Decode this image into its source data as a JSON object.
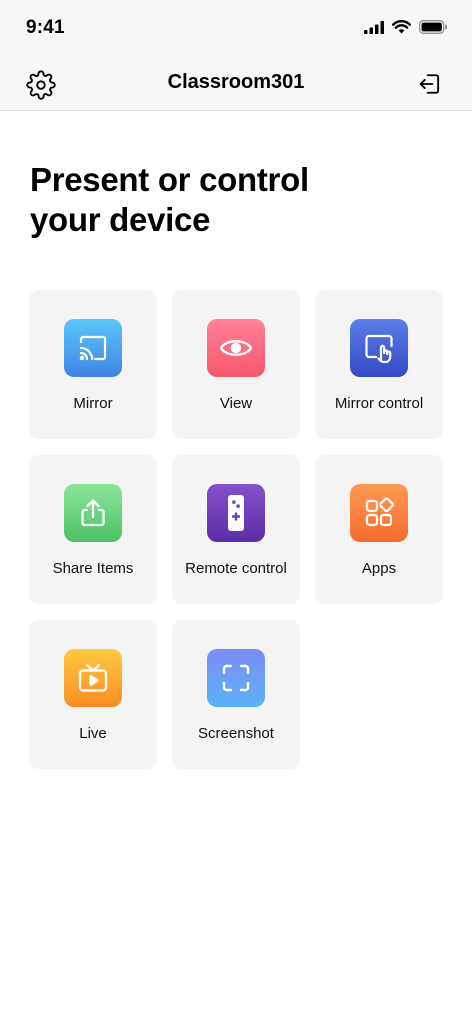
{
  "status_bar": {
    "time": "9:41"
  },
  "nav": {
    "title": "Classroom301",
    "left_icon": "gear-icon",
    "right_icon": "sign-out-icon"
  },
  "heading": "Present or control your device",
  "actions": [
    {
      "label": "Mirror",
      "icon": "cast-icon",
      "colors": [
        "#5ac8fa",
        "#3f84e5"
      ]
    },
    {
      "label": "View",
      "icon": "eye-icon",
      "colors": [
        "#ff8396",
        "#f5576c"
      ]
    },
    {
      "label": "Mirror control",
      "icon": "screen-touch-icon",
      "colors": [
        "#5b7fe8",
        "#3349c4"
      ]
    },
    {
      "label": "Share Items",
      "icon": "share-icon",
      "colors": [
        "#8ee49a",
        "#4cc266"
      ]
    },
    {
      "label": "Remote control",
      "icon": "remote-icon",
      "colors": [
        "#8450cc",
        "#5a2ea6"
      ]
    },
    {
      "label": "Apps",
      "icon": "apps-icon",
      "colors": [
        "#ff9a52",
        "#f76c2e"
      ]
    },
    {
      "label": "Live",
      "icon": "tv-icon",
      "colors": [
        "#ffc940",
        "#fb8c25"
      ]
    },
    {
      "label": "Screenshot",
      "icon": "screenshot-icon",
      "colors": [
        "#7d8cf5",
        "#5bb2f7"
      ]
    }
  ]
}
